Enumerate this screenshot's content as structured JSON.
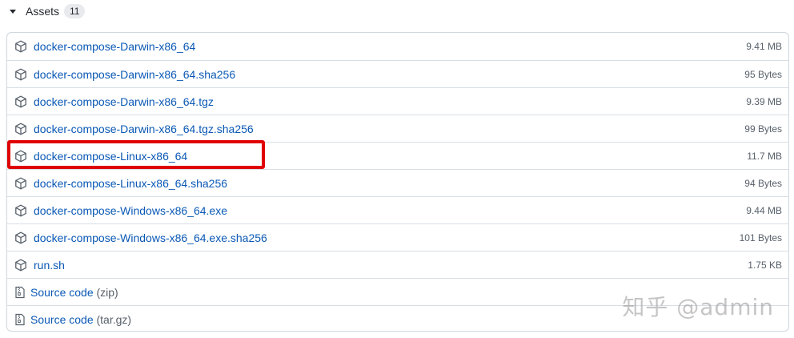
{
  "assets_section": {
    "title": "Assets",
    "count": "11"
  },
  "assets": [
    {
      "name": "docker-compose-Darwin-x86_64",
      "size": "9.41 MB",
      "icon": "package-icon"
    },
    {
      "name": "docker-compose-Darwin-x86_64.sha256",
      "size": "95 Bytes",
      "icon": "package-icon"
    },
    {
      "name": "docker-compose-Darwin-x86_64.tgz",
      "size": "9.39 MB",
      "icon": "package-icon"
    },
    {
      "name": "docker-compose-Darwin-x86_64.tgz.sha256",
      "size": "99 Bytes",
      "icon": "package-icon"
    },
    {
      "name": "docker-compose-Linux-x86_64",
      "size": "11.7 MB",
      "icon": "package-icon"
    },
    {
      "name": "docker-compose-Linux-x86_64.sha256",
      "size": "94 Bytes",
      "icon": "package-icon"
    },
    {
      "name": "docker-compose-Windows-x86_64.exe",
      "size": "9.44 MB",
      "icon": "package-icon"
    },
    {
      "name": "docker-compose-Windows-x86_64.exe.sha256",
      "size": "101 Bytes",
      "icon": "package-icon"
    },
    {
      "name": "run.sh",
      "size": "1.75 KB",
      "icon": "package-icon"
    }
  ],
  "source_code": [
    {
      "label": "Source code",
      "format": "(zip)",
      "icon": "file-zip-icon"
    },
    {
      "label": "Source code",
      "format": "(tar.gz)",
      "icon": "file-zip-icon"
    }
  ],
  "watermark": "知乎 @admin",
  "colors": {
    "link": "#0a58b5",
    "highlight": "#e00000",
    "border": "#d0d7de"
  }
}
